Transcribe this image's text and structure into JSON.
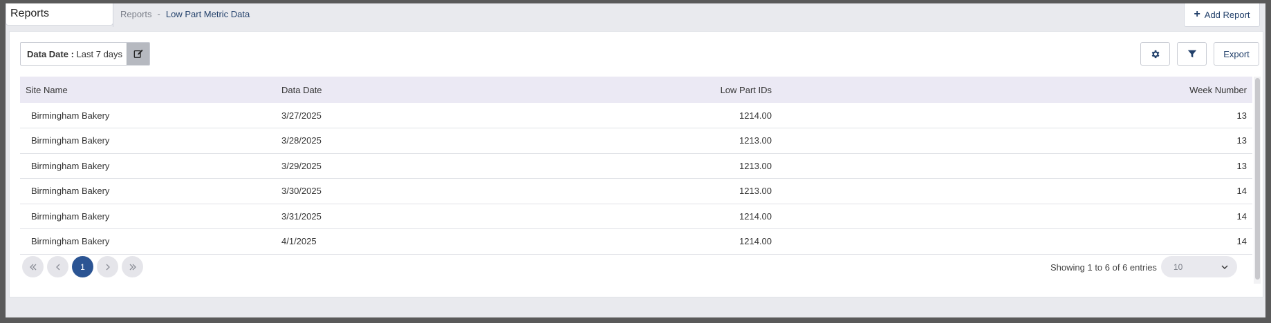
{
  "header": {
    "title": "Reports",
    "breadcrumb": [
      "Reports",
      "-",
      "Low Part Metric Data"
    ],
    "add_report_label": "Add Report"
  },
  "filters": {
    "date_label": "Data Date :",
    "date_value": "Last 7 days",
    "export_label": "Export"
  },
  "table": {
    "columns": [
      "Site Name",
      "Data Date",
      "Low Part IDs",
      "Week Number"
    ],
    "rows": [
      [
        "Birmingham Bakery",
        "3/27/2025",
        "1214.00",
        "13"
      ],
      [
        "Birmingham Bakery",
        "3/28/2025",
        "1213.00",
        "13"
      ],
      [
        "Birmingham Bakery",
        "3/29/2025",
        "1213.00",
        "13"
      ],
      [
        "Birmingham Bakery",
        "3/30/2025",
        "1213.00",
        "14"
      ],
      [
        "Birmingham Bakery",
        "3/31/2025",
        "1214.00",
        "14"
      ],
      [
        "Birmingham Bakery",
        "4/1/2025",
        "1214.00",
        "14"
      ]
    ]
  },
  "pagination": {
    "current_page": "1",
    "showing_text": "Showing 1 to 6 of 6 entries",
    "page_size": "10"
  },
  "colors": {
    "accent": "#2b5493",
    "header_row": "#ebe9f4"
  }
}
